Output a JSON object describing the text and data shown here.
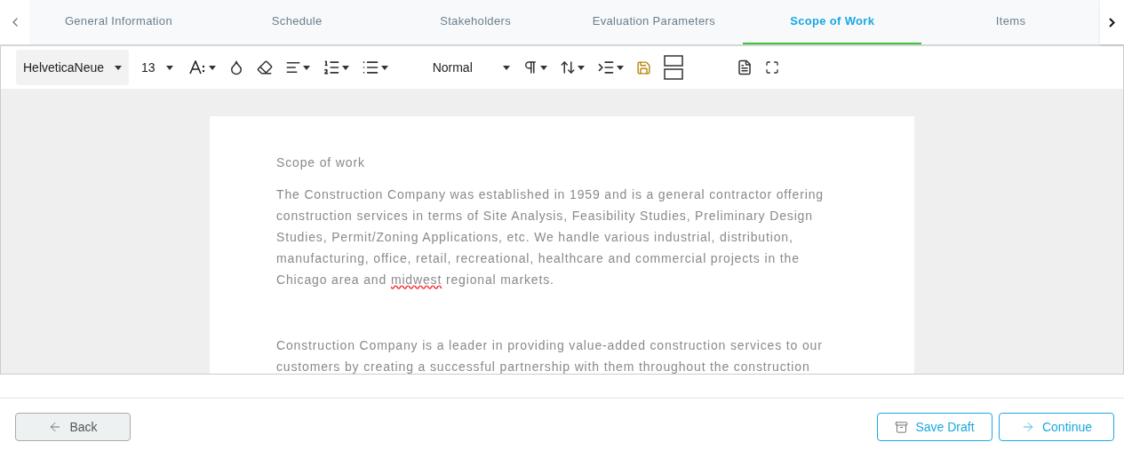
{
  "tabs": [
    {
      "label": "General Information",
      "selected": false
    },
    {
      "label": "Schedule",
      "selected": false
    },
    {
      "label": "Stakeholders",
      "selected": false
    },
    {
      "label": "Evaluation Parameters",
      "selected": false
    },
    {
      "label": "Scope of Work",
      "selected": true
    },
    {
      "label": "Items",
      "selected": false
    }
  ],
  "toolbar": {
    "font": "HelveticaNeue",
    "size": "13",
    "paragraph_style": "Normal"
  },
  "document": {
    "heading": "Scope of work",
    "paragraphs": [
      [
        {
          "text": "The Construction Company was established in 1959 and is a general contractor offering construction services in terms of Site Analysis, Feasibility Studies, Preliminary Design Studies, Permit/Zoning Applications, etc. We handle various industrial, distribution, manufacturing, office, retail, recreational, healthcare and commercial projects in the Chicago area and ",
          "misspelled": false
        },
        {
          "text": "midwest",
          "misspelled": true
        },
        {
          "text": " regional markets.",
          "misspelled": false
        }
      ],
      [
        {
          "text": "Construction Company is a leader in providing value-added construction services to our customers by creating a successful partnership with them throughout the construction",
          "misspelled": false
        }
      ]
    ]
  },
  "buttons": {
    "back": "Back",
    "save_draft": "Save Draft",
    "continue": "Continue"
  }
}
